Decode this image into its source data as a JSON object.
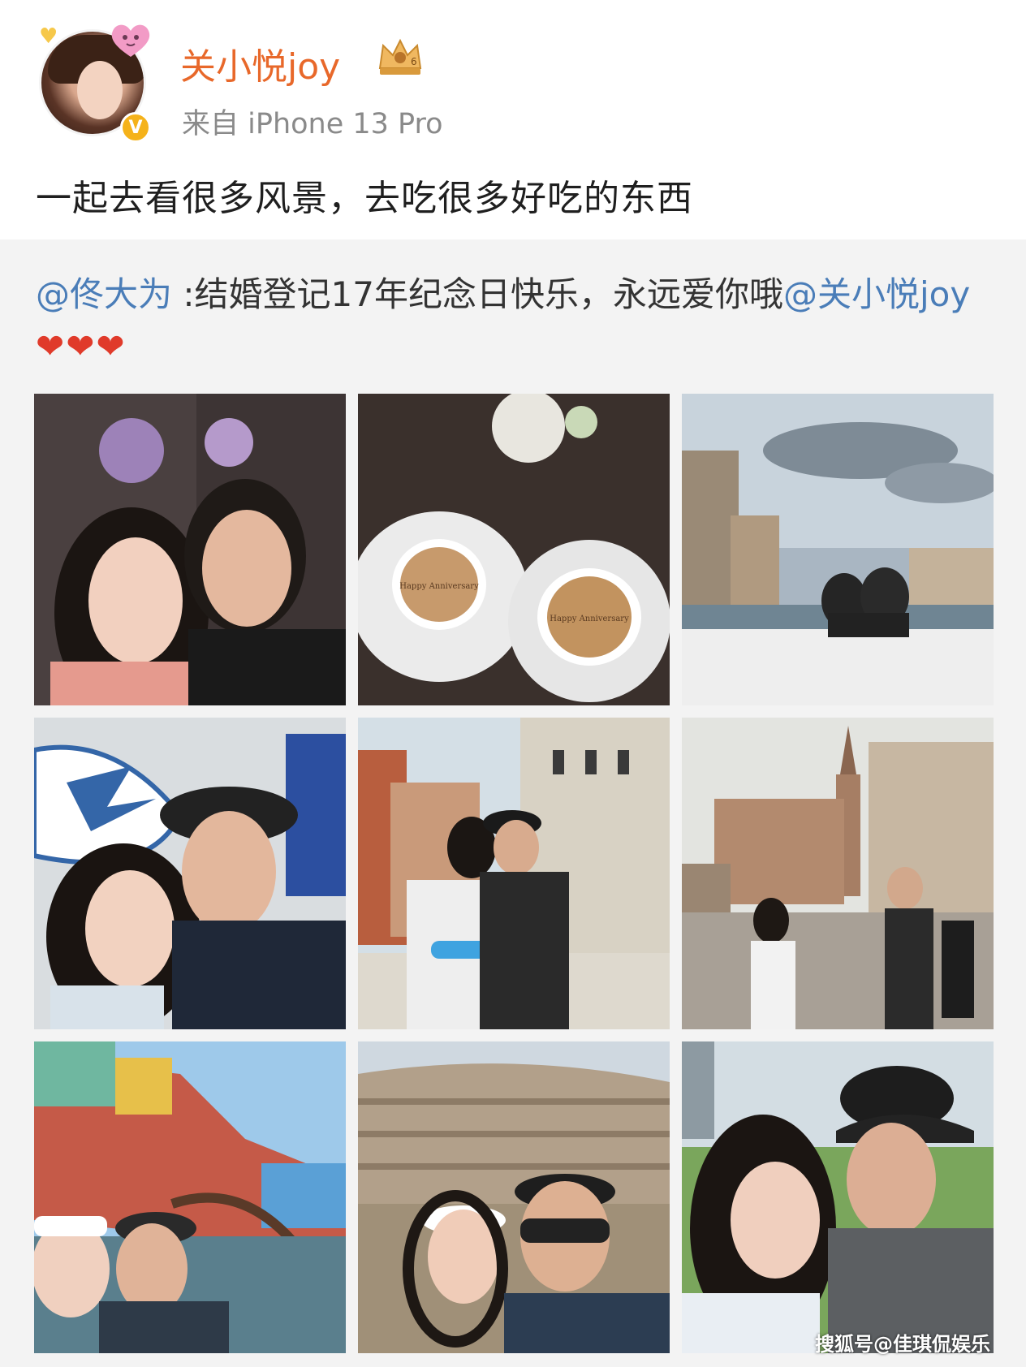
{
  "post": {
    "username": "关小悦joy",
    "source": "来自 iPhone 13 Pro",
    "text": "一起去看很多风景，去吃很多好吃的东西"
  },
  "repost": {
    "mention_author": "@佟大为",
    "body": " :结婚登记17年纪念日快乐，永远爱你哦",
    "mention_target": "@关小悦joy",
    "hearts": "❤❤❤"
  },
  "photos": [
    {
      "name": "photo-couple-selfie-flowers"
    },
    {
      "name": "photo-anniversary-coffee"
    },
    {
      "name": "photo-venice-boat"
    },
    {
      "name": "photo-couple-selfie-museum"
    },
    {
      "name": "photo-venice-kiss"
    },
    {
      "name": "photo-piazza-san-marco"
    },
    {
      "name": "photo-burano-selfie"
    },
    {
      "name": "photo-colosseum-selfie"
    },
    {
      "name": "photo-lawn-selfie"
    }
  ],
  "coffee_latte_art": "Happy Anniversary",
  "watermark": "搜狐号@佳琪侃娱乐",
  "colors": {
    "username": "#e8682a",
    "mention": "#4a7db8",
    "verified": "#f5b21a",
    "repost_bg": "#f3f3f3"
  }
}
